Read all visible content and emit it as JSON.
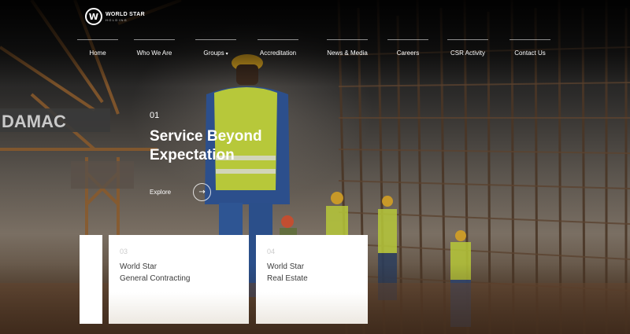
{
  "brand": {
    "name": "WORLD STAR",
    "sub": "HOLDING",
    "mark": "W"
  },
  "nav": {
    "items": [
      {
        "label": "Home"
      },
      {
        "label": "Who We Are"
      },
      {
        "label": "Groups"
      },
      {
        "label": "Accreditation"
      },
      {
        "label": "News & Media"
      },
      {
        "label": "Careers"
      },
      {
        "label": "CSR Activity"
      },
      {
        "label": "Contact Us"
      }
    ],
    "caret": "▾"
  },
  "hero": {
    "slide_number": "01",
    "headline_line1": "Service Beyond",
    "headline_line2": "Expectation",
    "explore_label": "Explore",
    "explore_icon": "arrow-right-icon",
    "explore_glyph": "→",
    "background_text": "DAMAC"
  },
  "cards": [
    {
      "number": "03",
      "line1": "World Star",
      "line2": "General Contracting"
    },
    {
      "number": "04",
      "line1": "World Star",
      "line2": "Real Estate"
    }
  ],
  "colors": {
    "accent_white": "#ffffff",
    "card_text": "#3c3c3c",
    "card_number": "#cbcbcb",
    "vest": "#b7c83a"
  }
}
